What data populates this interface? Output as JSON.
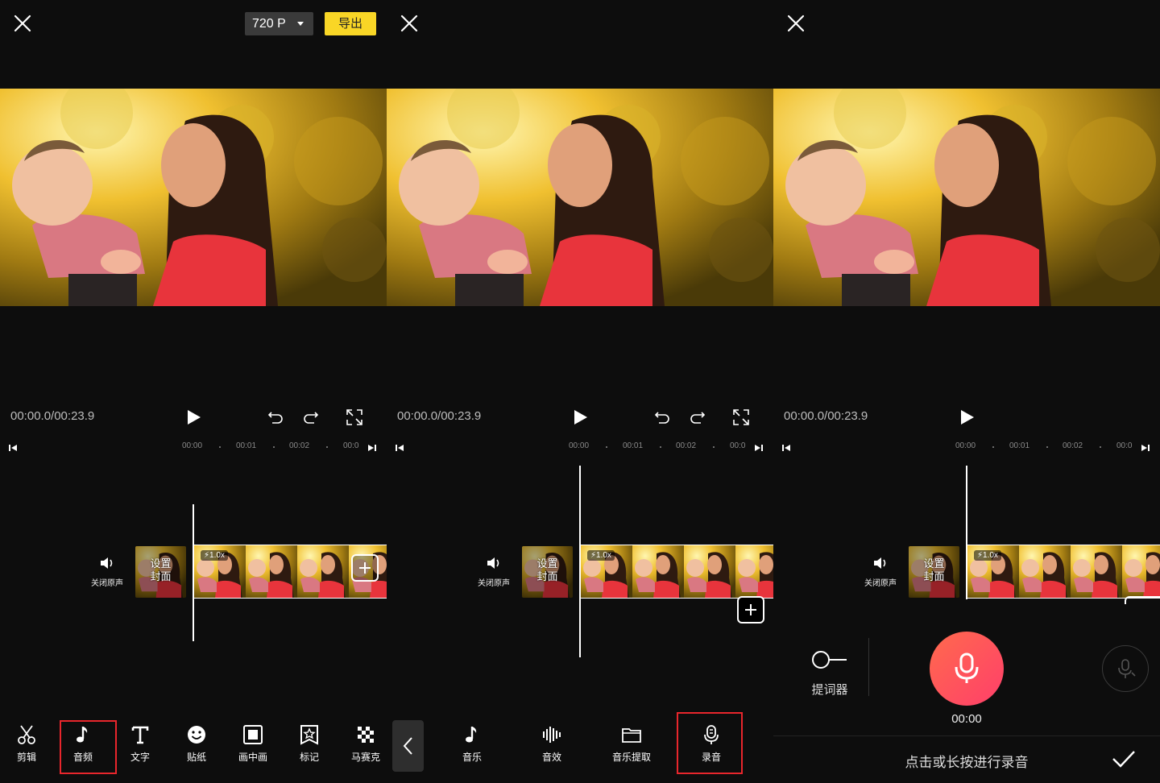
{
  "editor": {
    "resolution": "720 P",
    "export_label": "导出",
    "timecode": "00:00.0/00:23.9",
    "ruler": [
      "00:00",
      "00:01",
      "00:02",
      "00:0"
    ],
    "mute_label": "关闭原声",
    "cover_label_line1": "设置",
    "cover_label_line2": "封面",
    "speed_badge": "1.0x"
  },
  "toolbar_main": [
    {
      "label": "剪辑",
      "icon": "scissors-icon"
    },
    {
      "label": "音频",
      "icon": "music-note-icon"
    },
    {
      "label": "文字",
      "icon": "text-icon"
    },
    {
      "label": "贴纸",
      "icon": "smiley-icon"
    },
    {
      "label": "画中画",
      "icon": "picture-in-picture-icon"
    },
    {
      "label": "标记",
      "icon": "bookmark-star-icon"
    },
    {
      "label": "马赛克",
      "icon": "mosaic-icon"
    }
  ],
  "toolbar_audio": [
    {
      "label": "音乐",
      "icon": "music-note-icon"
    },
    {
      "label": "音效",
      "icon": "sound-wave-icon"
    },
    {
      "label": "音乐提取",
      "icon": "folder-icon"
    },
    {
      "label": "录音",
      "icon": "microphone-icon"
    }
  ],
  "recording": {
    "teleprompter_label": "提词器",
    "time": "00:00",
    "hint": "点击或长按进行录音"
  },
  "colors": {
    "export_yellow": "#f9d626",
    "highlight_red": "#e8262c",
    "record_gradient_start": "#ff6a4d",
    "record_gradient_end": "#ff3f6a"
  }
}
